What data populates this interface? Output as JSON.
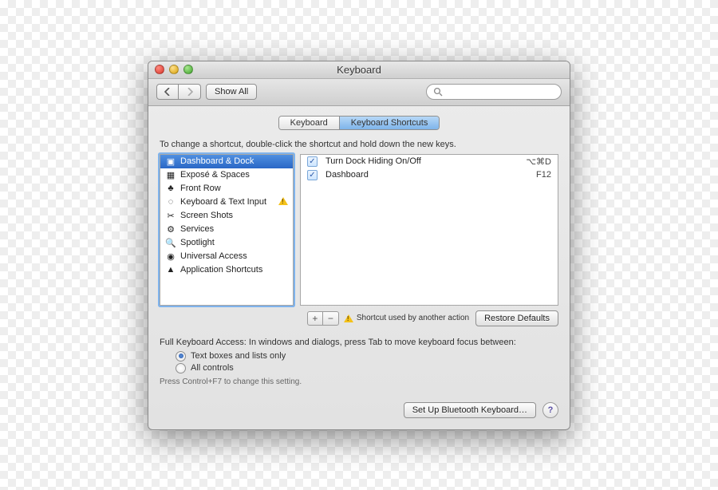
{
  "window": {
    "title": "Keyboard"
  },
  "toolbar": {
    "show_all": "Show All",
    "search_placeholder": ""
  },
  "tabs": {
    "keyboard": "Keyboard",
    "shortcuts": "Keyboard Shortcuts"
  },
  "instructions": "To change a shortcut, double-click the shortcut and hold down the new keys.",
  "categories": [
    {
      "label": "Dashboard & Dock",
      "icon": "▣",
      "selected": true
    },
    {
      "label": "Exposé & Spaces",
      "icon": "▦"
    },
    {
      "label": "Front Row",
      "icon": "♣"
    },
    {
      "label": "Keyboard & Text Input",
      "icon": "◌",
      "warning": true
    },
    {
      "label": "Screen Shots",
      "icon": "✂"
    },
    {
      "label": "Services",
      "icon": "⚙"
    },
    {
      "label": "Spotlight",
      "icon": "🔍"
    },
    {
      "label": "Universal Access",
      "icon": "◉"
    },
    {
      "label": "Application Shortcuts",
      "icon": "▲"
    }
  ],
  "shortcuts": [
    {
      "name": "Turn Dock Hiding On/Off",
      "keys": "⌥⌘D",
      "checked": true
    },
    {
      "name": "Dashboard",
      "keys": "F12",
      "checked": true
    }
  ],
  "add_remove": {
    "plus": "+",
    "minus": "−"
  },
  "conflict_msg": "Shortcut used by another action",
  "restore_defaults": "Restore Defaults",
  "fka": {
    "label": "Full Keyboard Access: In windows and dialogs, press Tab to move keyboard focus between:",
    "opt1": "Text boxes and lists only",
    "opt2": "All controls",
    "hint": "Press Control+F7 to change this setting."
  },
  "footer": {
    "bluetooth": "Set Up Bluetooth Keyboard…"
  }
}
